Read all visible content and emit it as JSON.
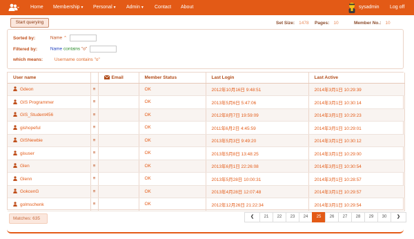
{
  "nav": {
    "brand_icon": "users-icon",
    "items": [
      {
        "label": "Home",
        "dropdown": false
      },
      {
        "label": "Membership",
        "dropdown": true
      },
      {
        "label": "Personal",
        "dropdown": true
      },
      {
        "label": "Admin",
        "dropdown": true
      },
      {
        "label": "Contact",
        "dropdown": false
      },
      {
        "label": "About",
        "dropdown": false
      }
    ],
    "user": "sysadmin",
    "logoff": "Log off"
  },
  "toolbar": {
    "query_button": "Start querying",
    "set_size_label": "Set Size:",
    "set_size_value": "1478",
    "pages_label": "Pages:",
    "pages_value": "10",
    "member_no_label": "Member No.:",
    "member_no_value": "10"
  },
  "filters": {
    "sorted_by_label": "Sorted by:",
    "sorted_by_field": "Name",
    "filtered_by_label": "Filtered by:",
    "filtered_by_field": "Name",
    "filtered_by_op": "contains",
    "filtered_by_value": "\"o\"",
    "means_label": "which means:",
    "means_text": "Username contains \"o\""
  },
  "table": {
    "columns": [
      "User name",
      "Email",
      "Member Status",
      "Last Login",
      "Last Active"
    ],
    "rows": [
      {
        "username": "Gdeon",
        "status": "OK",
        "last_login": "2012年10月16日 9:48:51",
        "last_active": "2014年3月1日 10:29:39"
      },
      {
        "username": "GIS Programmer",
        "status": "OK",
        "last_login": "2013年5月6日 5:47:06",
        "last_active": "2014年3月1日 10:30:14"
      },
      {
        "username": "GIS_Student456",
        "status": "OK",
        "last_login": "2012年8月7日 19:59:09",
        "last_active": "2014年3月1日 10:29:23"
      },
      {
        "username": "gishopeful",
        "status": "OK",
        "last_login": "2011年6月2日 4:45:59",
        "last_active": "2014年3月1日 10:29:01"
      },
      {
        "username": "GISNewbie",
        "status": "OK",
        "last_login": "2013年5月3日 9:49:20",
        "last_active": "2014年3月1日 10:30:12"
      },
      {
        "username": "gisuser",
        "status": "OK",
        "last_login": "2013年5月8日 13:48:25",
        "last_active": "2014年3月1日 10:29:00"
      },
      {
        "username": "Glen",
        "status": "OK",
        "last_login": "2013年6月1日 22:26:08",
        "last_active": "2014年3月1日 10:30:54"
      },
      {
        "username": "Glenn",
        "status": "OK",
        "last_login": "2013年5月28日 10:00:31",
        "last_active": "2014年3月1日 10:28:57"
      },
      {
        "username": "GokcenG",
        "status": "OK",
        "last_login": "2013年4月28日 12:07:48",
        "last_active": "2014年3月1日 10:29:57"
      },
      {
        "username": "golmschenk",
        "status": "OK",
        "last_login": "2012年12月26日 21:22:34",
        "last_active": "2014年3月1日 10:29:54"
      }
    ]
  },
  "footer": {
    "matches": "Matches: 635",
    "pages": [
      "21",
      "22",
      "23",
      "24",
      "25",
      "26",
      "27",
      "28",
      "29",
      "30"
    ],
    "active_page": "25",
    "prev_icon": "chevron-left-icon",
    "next_icon": "chevron-right-icon"
  },
  "colors": {
    "accent": "#e35a16",
    "header_text": "#b04a17",
    "row_alt": "#f9f4f1"
  }
}
